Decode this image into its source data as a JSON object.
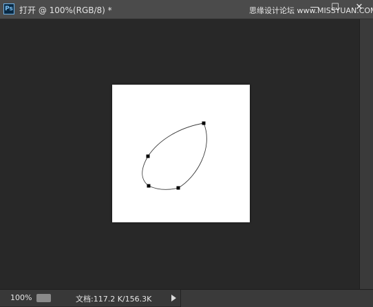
{
  "window": {
    "title": "打开 @ 100%(RGB/8) *",
    "app_icon_label": "Ps",
    "watermark": "思缘设计论坛 www.MISSYUAN.COM",
    "minimize_label": "—",
    "maximize_label": "☐",
    "close_label": "✕"
  },
  "status": {
    "zoom": "100%",
    "doc_size": "文档:117.2 K/156.3K"
  },
  "canvas": {
    "background": "#282828",
    "document_color": "#ffffff"
  }
}
